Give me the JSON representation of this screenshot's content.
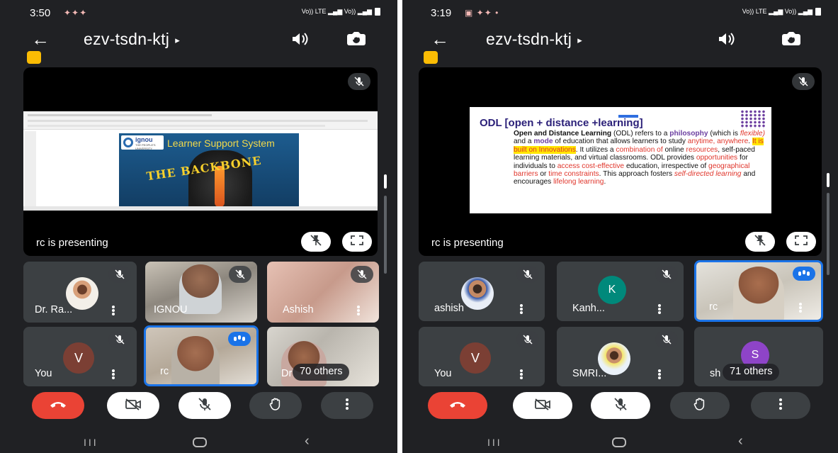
{
  "screens": [
    {
      "time": "3:50",
      "notif_icons": "✦✦✦",
      "signal_text": "Vo)) LTE ▂▄▆ Vo)) ▂▄▆",
      "meeting_code": "ezv-tsdn-ktj",
      "presenting_label": "rc is presenting",
      "slide": {
        "headline": "Learner Support System",
        "logo_text": "ignou",
        "logo_sub": "THE PEOPLE'S UNIVERSITY",
        "overlay_text": "THE BACKBONE"
      },
      "participants": [
        {
          "name": "Dr. Ra...",
          "muted": true
        },
        {
          "name": "IGNOU",
          "muted": true
        },
        {
          "name": "Ashish",
          "muted": true
        },
        {
          "name": "You",
          "initial": "V",
          "muted": true
        },
        {
          "name": "rc",
          "speaking": true
        },
        {
          "name": "Dr",
          "others_label": "70 others"
        }
      ]
    },
    {
      "time": "3:19",
      "notif_icons": "▣ ✦✦ •",
      "signal_text": "Vo)) LTE ▂▄▆ Vo)) ▂▄▆",
      "meeting_code": "ezv-tsdn-ktj",
      "presenting_label": "rc is presenting",
      "slide": {
        "headline": "ODL [open + distance +learning]",
        "body": [
          {
            "t": "Open and Distance Learning",
            "s": "bold"
          },
          {
            "t": " (ODL) refers to a ",
            "s": ""
          },
          {
            "t": "philosophy",
            "s": "purple"
          },
          {
            "t": " (which is ",
            "s": ""
          },
          {
            "t": "flexible)",
            "s": "italic"
          },
          {
            "t": " and a ",
            "s": ""
          },
          {
            "t": "mode",
            "s": "purple"
          },
          {
            "t": " of education that allows learners to study ",
            "s": ""
          },
          {
            "t": "anytime, anywhere",
            "s": "red"
          },
          {
            "t": ". ",
            "s": ""
          },
          {
            "t": "It is built on Innovations",
            "s": "yellow"
          },
          {
            "t": ". It utilizes a ",
            "s": ""
          },
          {
            "t": "combination of",
            "s": "red"
          },
          {
            "t": " online ",
            "s": ""
          },
          {
            "t": "resources",
            "s": "red"
          },
          {
            "t": ", self-paced learning materials, and virtual classrooms. ODL provides ",
            "s": ""
          },
          {
            "t": "opportunities",
            "s": "red"
          },
          {
            "t": " for individuals to ",
            "s": ""
          },
          {
            "t": "access cost-effective",
            "s": "red"
          },
          {
            "t": " education, irrespective of ",
            "s": ""
          },
          {
            "t": "geographical barriers",
            "s": "red"
          },
          {
            "t": " or ",
            "s": ""
          },
          {
            "t": "time constraints",
            "s": "red"
          },
          {
            "t": ". This approach fosters ",
            "s": ""
          },
          {
            "t": "self-directed learning",
            "s": "italic"
          },
          {
            "t": " and encourages ",
            "s": ""
          },
          {
            "t": "lifelong learning",
            "s": "red"
          },
          {
            "t": ".",
            "s": ""
          }
        ]
      },
      "participants": [
        {
          "name": "ashish",
          "muted": true
        },
        {
          "name": "Kanh...",
          "initial": "K",
          "muted": true
        },
        {
          "name": "rc",
          "speaking": true
        },
        {
          "name": "You",
          "initial": "V",
          "muted": true
        },
        {
          "name": "SMRI...",
          "muted": true
        },
        {
          "name": "sh",
          "initial": "S",
          "others_label": "71 others"
        }
      ]
    }
  ],
  "colors": {
    "end_call": "#ea4335",
    "speaking": "#1a73e8",
    "avatar_v": "#7b3f34",
    "avatar_k": "#00897b",
    "avatar_s": "#8e44c8",
    "badge": "#fbbc04"
  },
  "icons": [
    "back-arrow-icon",
    "chevron-right-icon",
    "speaker-icon",
    "switch-camera-icon",
    "mic-off-icon",
    "pin-off-icon",
    "fullscreen-icon",
    "end-call-icon",
    "camera-off-icon",
    "raise-hand-icon",
    "more-vert-icon"
  ]
}
